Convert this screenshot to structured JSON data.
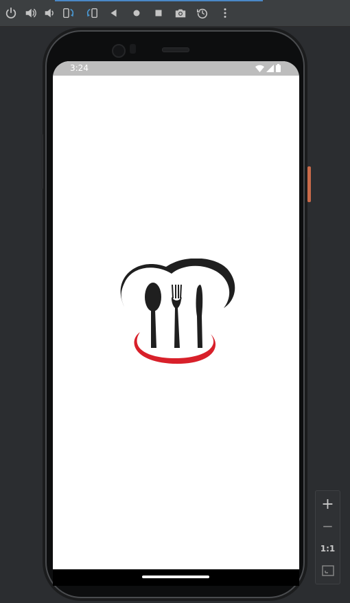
{
  "toolbar": {
    "buttons": [
      {
        "name": "power-icon"
      },
      {
        "name": "volume-up-icon"
      },
      {
        "name": "volume-down-icon"
      },
      {
        "name": "rotate-left-icon"
      },
      {
        "name": "rotate-right-icon"
      },
      {
        "name": "back-icon"
      },
      {
        "name": "home-icon"
      },
      {
        "name": "overview-icon"
      },
      {
        "name": "camera-icon"
      },
      {
        "name": "snapshot-icon"
      },
      {
        "name": "more-icon"
      }
    ],
    "accent_color": "#4a88c7"
  },
  "device": {
    "status_bar": {
      "time": "3:24",
      "icons": [
        "wifi-icon",
        "cellular-icon",
        "battery-icon"
      ],
      "background": "#bdbdbd"
    },
    "screen_background": "#ffffff",
    "logo": {
      "name": "chef-hat-cutlery-logo",
      "colors": {
        "dark": "#1f1f1f",
        "accent": "#d8202a"
      }
    },
    "power_button_color": "#c96b4a"
  },
  "zoom_panel": {
    "zoom_in": "+",
    "zoom_out": "−",
    "actual_size": "1:1",
    "fit_screen": "fit-screen-icon"
  }
}
